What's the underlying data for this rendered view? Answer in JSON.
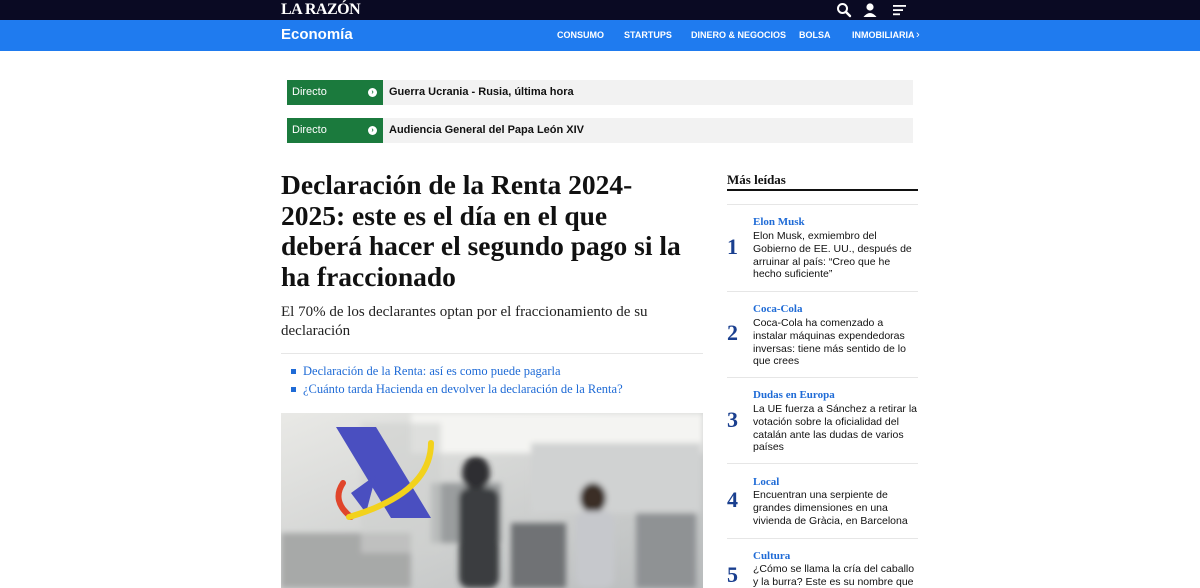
{
  "header": {
    "logo": "LA RAZÓN",
    "icons": [
      "search-icon",
      "user-icon",
      "menu-icon"
    ]
  },
  "section": {
    "title": "Economía",
    "nav": [
      "CONSUMO",
      "STARTUPS",
      "DINERO & NEGOCIOS",
      "BOLSA",
      "INMOBILIARIA"
    ],
    "more": "›"
  },
  "live": [
    {
      "tag": "Directo",
      "text": "Guerra Ucrania - Rusia, última hora"
    },
    {
      "tag": "Directo",
      "text": "Audiencia General del Papa León XIV"
    }
  ],
  "article": {
    "headline": "Declaración de la Renta 2024-2025: este es el día en el que deberá hacer el segundo pago si la ha fraccionado",
    "subhead": "El 70% de los declarantes optan por el fraccionamiento de su declaración",
    "related": [
      "Declaración de la Renta: así es como puede pagarla",
      "¿Cuánto tarda Hacienda en devolver la declaración de la Renta?"
    ]
  },
  "sidebar": {
    "title": "Más leídas",
    "items": [
      {
        "num": "1",
        "cat": "Elon Musk",
        "text": "Elon Musk, exmiembro del Gobierno de EE. UU., después de arruinar al país: “Creo que he hecho suficiente”"
      },
      {
        "num": "2",
        "cat": "Coca-Cola",
        "text": "Coca-Cola ha comenzado a instalar máquinas expendedoras inversas: tiene más sentido de lo que crees"
      },
      {
        "num": "3",
        "cat": "Dudas en Europa",
        "text": "La UE fuerza a Sánchez a retirar la votación sobre la oficialidad del catalán ante las dudas de varios países"
      },
      {
        "num": "4",
        "cat": "Local",
        "text": "Encuentran una serpiente de grandes dimensiones en una vivienda de Gràcia, en Barcelona"
      },
      {
        "num": "5",
        "cat": "Cultura",
        "text": "¿Cómo se llama la cría del caballo y la burra? Este es su nombre que"
      }
    ]
  },
  "colors": {
    "topbar": "#0a0a23",
    "section": "#1f7bef",
    "live_tag": "#1b7a3d",
    "link": "#1f6bd6",
    "rank_number": "#1a3f8f"
  }
}
